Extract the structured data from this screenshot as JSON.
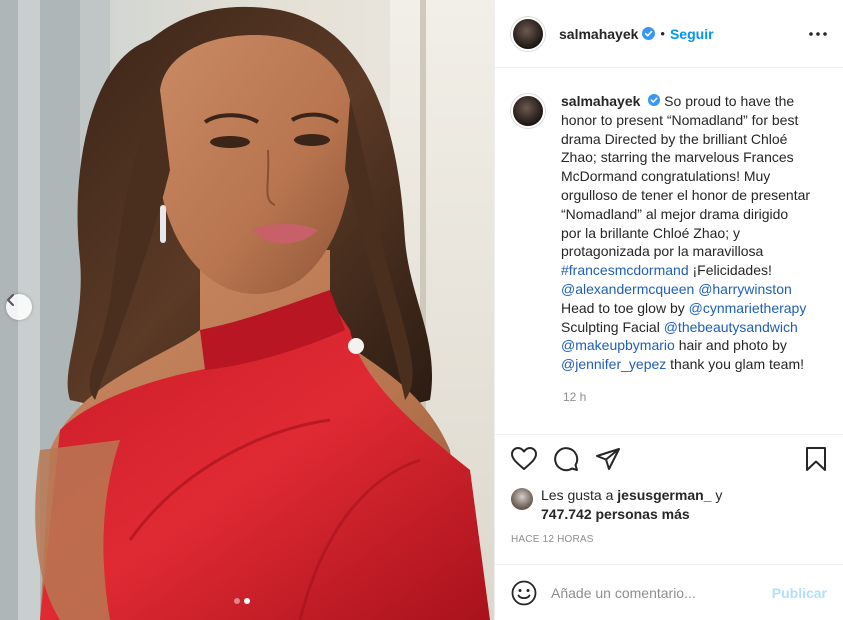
{
  "post": {
    "author": {
      "username": "salmahayek",
      "verified": true,
      "avatar_icon": "profile-avatar"
    },
    "header": {
      "separator": "•",
      "follow_label": "Seguir",
      "more_icon": "more-options-icon"
    },
    "caption": {
      "username": "salmahayek",
      "segments": [
        {
          "type": "text",
          "value": " So proud to have the honor to present “Nomadland” for best drama Directed by the brilliant Chloé Zhao; starring the marvelous Frances McDormand congratulations! Muy orgulloso de tener el honor de presentar “Nomadland” al mejor drama dirigido por la brillante Chloé Zhao; y protagonizada por la maravillosa "
        },
        {
          "type": "tag",
          "value": "#francesmcdormand"
        },
        {
          "type": "text",
          "value": " ¡Felicidades! "
        },
        {
          "type": "tag",
          "value": "@alexandermcqueen"
        },
        {
          "type": "text",
          "value": " "
        },
        {
          "type": "tag",
          "value": "@harrywinston"
        },
        {
          "type": "text",
          "value": " Head to toe glow by "
        },
        {
          "type": "tag",
          "value": "@cynmarietherapy"
        },
        {
          "type": "text",
          "value": " Sculpting Facial "
        },
        {
          "type": "tag",
          "value": "@thebeautysandwich"
        },
        {
          "type": "text",
          "value": " "
        },
        {
          "type": "tag",
          "value": "@makeupbymario"
        },
        {
          "type": "text",
          "value": " hair and photo by "
        },
        {
          "type": "tag",
          "value": "@jennifer_yepez"
        },
        {
          "type": "text",
          "value": " thank you glam team!"
        }
      ],
      "relative_time": "12 h"
    },
    "actions": {
      "like_icon": "heart-icon",
      "comment_icon": "comment-icon",
      "share_icon": "share-icon",
      "save_icon": "bookmark-icon"
    },
    "likes": {
      "prefix": "Les gusta a ",
      "first_liker": "jesusgerman_",
      "middle": " y ",
      "others": "747.742 personas más"
    },
    "timestamp": "HACE 12 HORAS",
    "comment": {
      "emoji_icon": "emoji-icon",
      "placeholder": "Añade un comentario...",
      "publish_label": "Publicar"
    },
    "carousel": {
      "current": 2,
      "total": 2,
      "prev_icon": "chevron-left-icon"
    },
    "colors": {
      "accent": "#0095f6",
      "link": "#1f5fb8",
      "publish_disabled": "#b2dffc",
      "dress_red": "#d41f2b",
      "verified_badge": "#3897f0"
    }
  }
}
